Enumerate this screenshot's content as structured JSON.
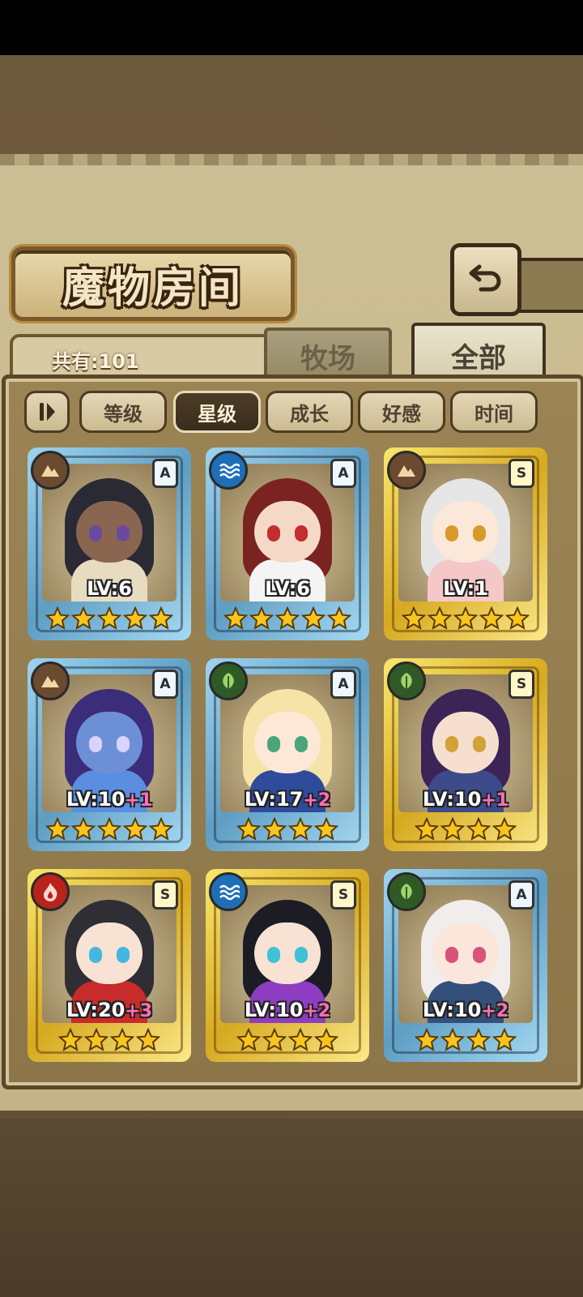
{
  "header": {
    "title": "魔物房间"
  },
  "count_label": "共有:101",
  "tabs": [
    {
      "label": "牧场"
    },
    {
      "label": "全部"
    }
  ],
  "sort": {
    "buttons": [
      {
        "label": "等级"
      },
      {
        "label": "星级"
      },
      {
        "label": "成长"
      },
      {
        "label": "好感"
      },
      {
        "label": "时间"
      }
    ],
    "active": "星级"
  },
  "colors": {
    "rank_A": "#5e9ec3",
    "rank_S": "#d6a920",
    "star": "#f7c51e",
    "plus": "#ff6fb3"
  },
  "monsters": [
    {
      "element": "earth-icon",
      "rank": "A",
      "level_label": "LV:6",
      "bonus": "",
      "stars": 5,
      "hair": "#2a2a35",
      "skin": "#8a6550",
      "eyes": "#6a4aa0",
      "outfit": "#e8dcc0"
    },
    {
      "element": "water-icon",
      "rank": "A",
      "level_label": "LV:6",
      "bonus": "",
      "stars": 5,
      "hair": "#7a2320",
      "skin": "#f4d9c6",
      "eyes": "#c42d2d",
      "outfit": "#f4f4f4"
    },
    {
      "element": "earth-icon",
      "rank": "S",
      "level_label": "LV:1",
      "bonus": "",
      "stars": 5,
      "hair": "#e6e6e6",
      "skin": "#fbe8d8",
      "eyes": "#d79a2a",
      "outfit": "#f6c7c7"
    },
    {
      "element": "earth-icon",
      "rank": "A",
      "level_label": "LV:10",
      "bonus": "+1",
      "stars": 5,
      "hair": "#3b2d7a",
      "skin": "#6d8fd6",
      "eyes": "#d8d4ff",
      "outfit": "#5b8ee0"
    },
    {
      "element": "grass-icon",
      "rank": "A",
      "level_label": "LV:17",
      "bonus": "+2",
      "stars": 4,
      "hair": "#f5e3a8",
      "skin": "#fde8d8",
      "eyes": "#4aa57a",
      "outfit": "#2f4b9c"
    },
    {
      "element": "grass-icon",
      "rank": "S",
      "level_label": "LV:10",
      "bonus": "+1",
      "stars": 4,
      "hair": "#3c2457",
      "skin": "#f6dfcf",
      "eyes": "#d2a23a",
      "outfit": "#3d4b8a"
    },
    {
      "element": "fire-icon",
      "rank": "S",
      "level_label": "LV:20",
      "bonus": "+3",
      "stars": 4,
      "hair": "#2e2e34",
      "skin": "#f8e2d4",
      "eyes": "#44b7e0",
      "outfit": "#c82b2b"
    },
    {
      "element": "water-icon",
      "rank": "S",
      "level_label": "LV:10",
      "bonus": "+2",
      "stars": 4,
      "hair": "#1c1c24",
      "skin": "#f8e2d4",
      "eyes": "#3fc1d6",
      "outfit": "#8e3dc2"
    },
    {
      "element": "grass-icon",
      "rank": "A",
      "level_label": "LV:10",
      "bonus": "+2",
      "stars": 4,
      "hair": "#f1eded",
      "skin": "#fbe6dc",
      "eyes": "#d9527a",
      "outfit": "#34507a"
    }
  ]
}
